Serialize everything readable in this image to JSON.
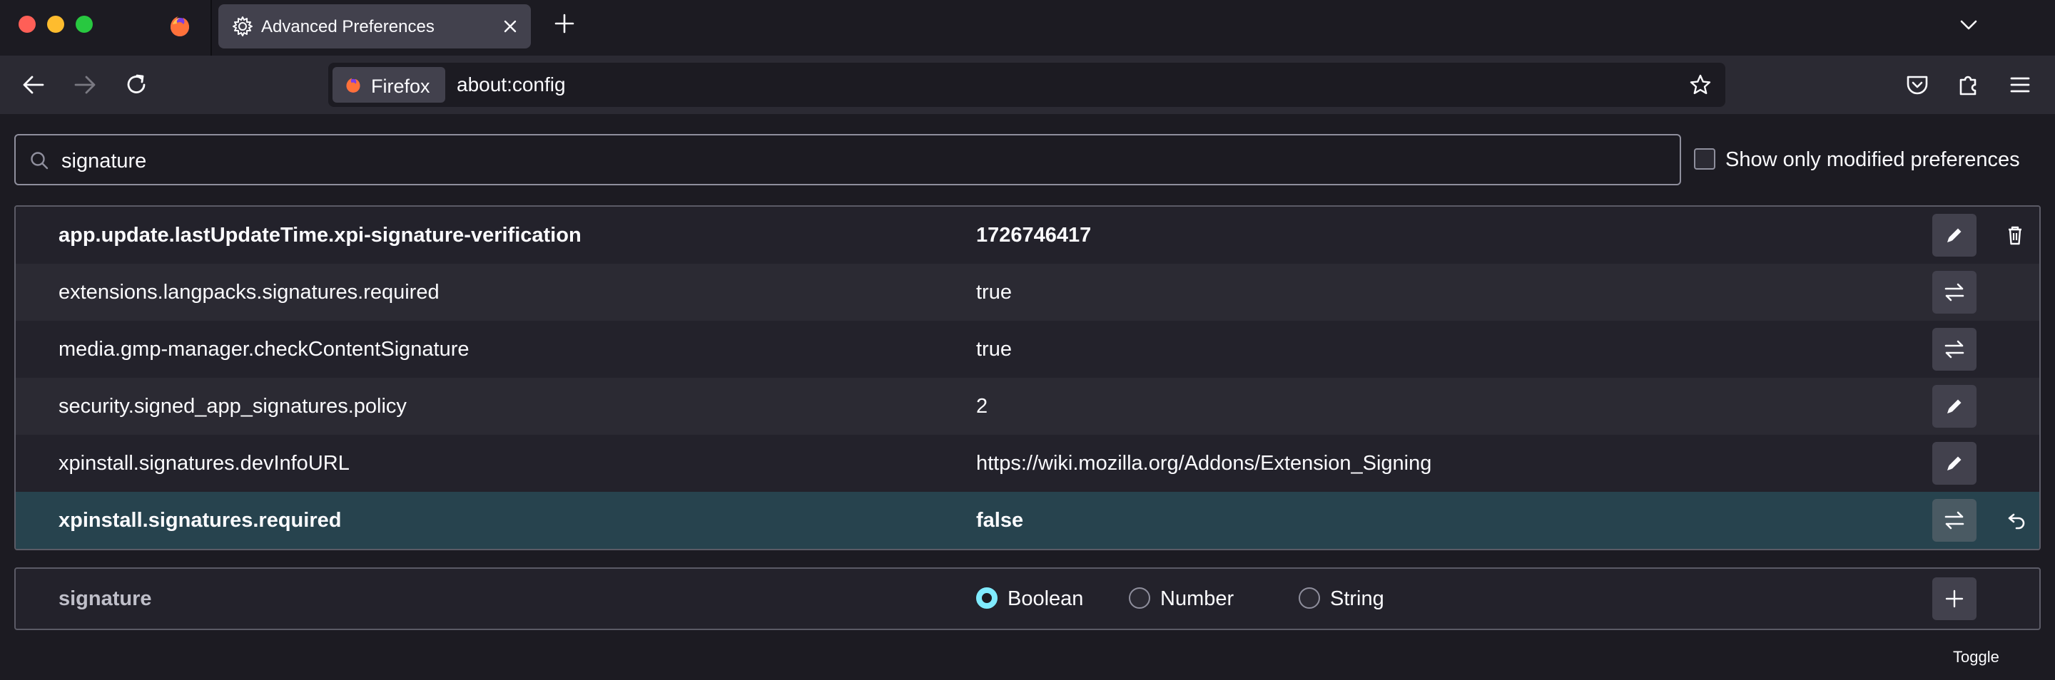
{
  "tabs": {
    "pinned_icon": "firefox-logo-icon",
    "active": {
      "title": "Advanced Preferences",
      "icon": "gear-icon"
    }
  },
  "navbar": {
    "identity_label": "Firefox",
    "url": "about:config"
  },
  "search": {
    "value": "signature",
    "icon": "search-icon"
  },
  "filter": {
    "label": "Show only modified preferences",
    "checked": false
  },
  "prefs": [
    {
      "name": "app.update.lastUpdateTime.xpi-signature-verification",
      "value": "1726746417",
      "modified": true,
      "action": "edit",
      "trailing": "delete"
    },
    {
      "name": "extensions.langpacks.signatures.required",
      "value": "true",
      "modified": false,
      "action": "toggle",
      "trailing": ""
    },
    {
      "name": "media.gmp-manager.checkContentSignature",
      "value": "true",
      "modified": false,
      "action": "toggle",
      "trailing": ""
    },
    {
      "name": "security.signed_app_signatures.policy",
      "value": "2",
      "modified": false,
      "action": "edit",
      "trailing": ""
    },
    {
      "name": "xpinstall.signatures.devInfoURL",
      "value": "https://wiki.mozilla.org/Addons/Extension_Signing",
      "modified": false,
      "action": "edit",
      "trailing": ""
    },
    {
      "name": "xpinstall.signatures.required",
      "value": "false",
      "modified": true,
      "action": "toggle",
      "trailing": "reset"
    }
  ],
  "tooltip": "Toggle",
  "add_row": {
    "name": "signature",
    "types": [
      "Boolean",
      "Number",
      "String"
    ],
    "selected_type": "Boolean"
  },
  "colors": {
    "accent": "#80ebff",
    "highlight_row": "#27434e",
    "background": "#1c1b22"
  }
}
